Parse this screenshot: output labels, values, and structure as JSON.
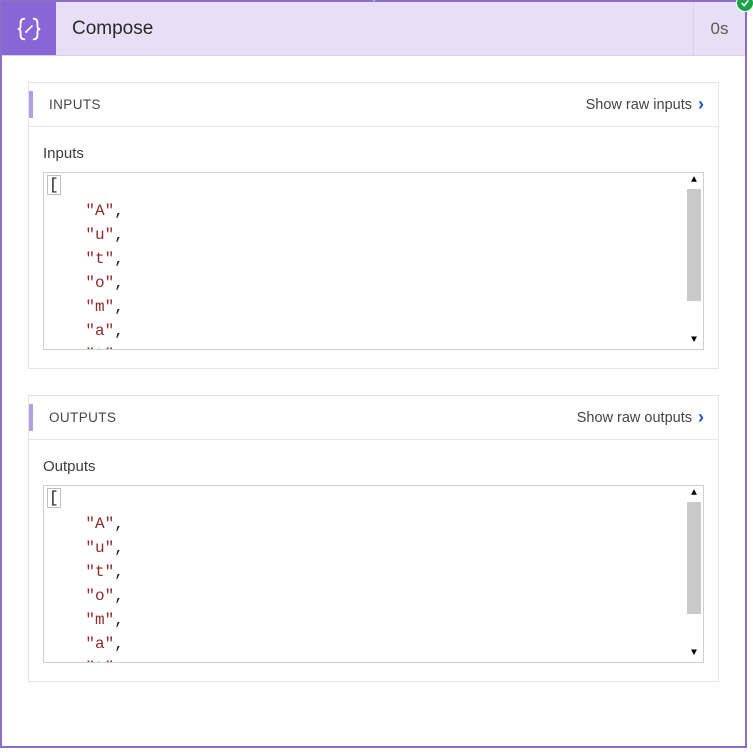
{
  "header": {
    "title": "Compose",
    "duration": "0s",
    "icon": "compose-braces-icon",
    "status": "success"
  },
  "panels": {
    "inputs": {
      "header": "INPUTS",
      "link": "Show raw inputs",
      "body_label": "Inputs",
      "code": {
        "open": "[",
        "lines": [
          "\"A\",",
          "\"u\",",
          "\"t\",",
          "\"o\",",
          "\"m\",",
          "\"a\",",
          "\"t\""
        ]
      }
    },
    "outputs": {
      "header": "OUTPUTS",
      "link": "Show raw outputs",
      "body_label": "Outputs",
      "code": {
        "open": "[",
        "lines": [
          "\"A\",",
          "\"u\",",
          "\"t\",",
          "\"o\",",
          "\"m\",",
          "\"a\",",
          "\"t\""
        ]
      }
    }
  }
}
